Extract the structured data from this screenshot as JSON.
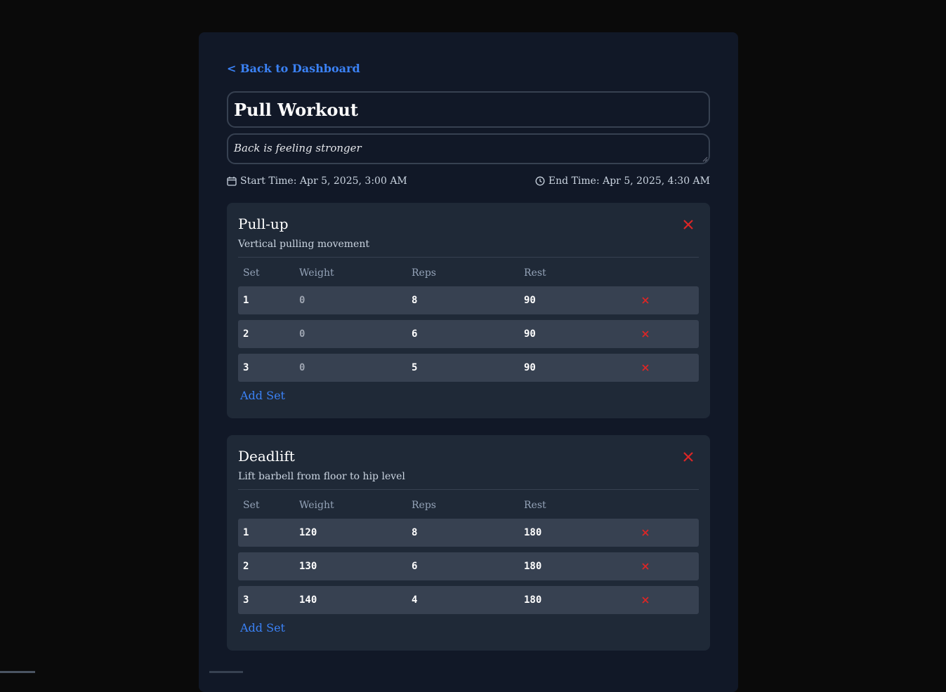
{
  "nav": {
    "back_label": "< Back to Dashboard"
  },
  "workout": {
    "title": "Pull Workout",
    "notes": "Back is feeling stronger",
    "start_time": "Start Time: Apr 5, 2025, 3:00 AM",
    "end_time": "End Time: Apr 5, 2025, 4:30 AM"
  },
  "table_headers": {
    "set": "Set",
    "weight": "Weight",
    "reps": "Reps",
    "rest": "Rest"
  },
  "exercises": [
    {
      "name": "Pull-up",
      "description": "Vertical pulling movement",
      "add_set_label": "Add Set",
      "sets": [
        {
          "set": "1",
          "weight": "0",
          "reps": "8",
          "rest": "90"
        },
        {
          "set": "2",
          "weight": "0",
          "reps": "6",
          "rest": "90"
        },
        {
          "set": "3",
          "weight": "0",
          "reps": "5",
          "rest": "90"
        }
      ]
    },
    {
      "name": "Deadlift",
      "description": "Lift barbell from floor to hip level",
      "add_set_label": "Add Set",
      "sets": [
        {
          "set": "1",
          "weight": "120",
          "reps": "8",
          "rest": "180"
        },
        {
          "set": "2",
          "weight": "130",
          "reps": "6",
          "rest": "180"
        },
        {
          "set": "3",
          "weight": "140",
          "reps": "4",
          "rest": "180"
        }
      ]
    }
  ],
  "icons": {
    "start": "calendar-icon",
    "end": "clock-icon",
    "remove_exercise": "close-icon",
    "remove_set": "close-icon"
  },
  "colors": {
    "accent": "#3b82f6",
    "danger": "#dc2626",
    "panel": "#111827",
    "card": "#1f2937",
    "row": "#374151"
  }
}
